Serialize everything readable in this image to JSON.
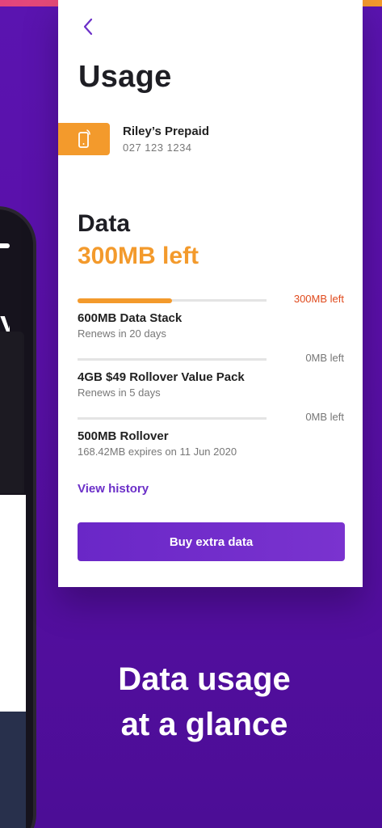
{
  "header": {
    "title": "Usage",
    "back_icon": "chevron-left-icon"
  },
  "account": {
    "icon": "phone-icon",
    "name": "Riley’s Prepaid",
    "number": "027 123 1234"
  },
  "data": {
    "heading": "Data",
    "remaining": "300MB left",
    "items": [
      {
        "name": "600MB Data Stack",
        "sub": "Renews in 20 days",
        "remaining": "300MB left",
        "fraction_remaining": 0.5
      },
      {
        "name": "4GB $49 Rollover Value Pack",
        "sub": "Renews in 5 days",
        "remaining": "0MB left",
        "fraction_remaining": 0
      },
      {
        "name": "500MB Rollover",
        "sub": "168.42MB expires on 11 Jun 2020",
        "remaining": "0MB left",
        "fraction_remaining": 0
      }
    ]
  },
  "actions": {
    "view_history": "View history",
    "buy_extra": "Buy extra data"
  },
  "tagline": {
    "line1": "Data usage",
    "line2": "at a glance"
  },
  "colors": {
    "accent_orange": "#f39a2c",
    "accent_purple": "#6b2fc8",
    "alert_red": "#e04a1d",
    "background_purple": "#5a14b0"
  }
}
